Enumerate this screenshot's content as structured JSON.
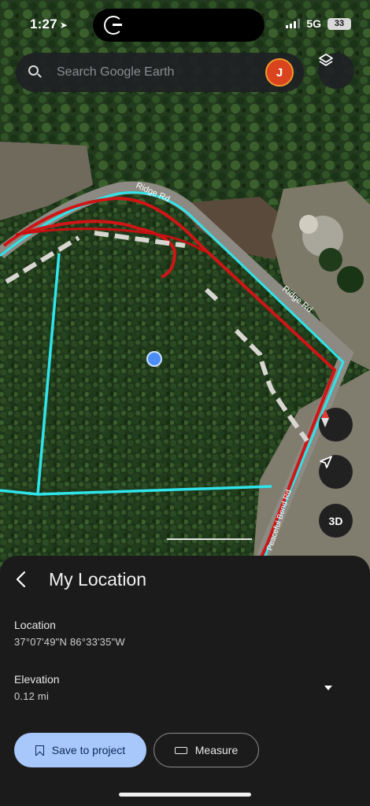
{
  "status_bar": {
    "time": "1:27",
    "network": "5G",
    "battery": "33"
  },
  "search": {
    "placeholder": "Search Google Earth",
    "avatar_initial": "J"
  },
  "map": {
    "road_labels": [
      "Ridge Rd",
      "Ridge Rd",
      "Peaceful Bend Rd"
    ],
    "view_3d_label": "3D"
  },
  "sheet": {
    "title": "My Location",
    "location_label": "Location",
    "location_value": "37°07'49\"N 86°33'35\"W",
    "elevation_label": "Elevation",
    "elevation_value": "0.12 mi",
    "save_label": "Save to project",
    "measure_label": "Measure"
  },
  "colors": {
    "boundary_red": "#d01515",
    "boundary_cyan": "#2fe4ea",
    "location_dot": "#4a8ef5",
    "save_button": "#a8c7fa"
  }
}
